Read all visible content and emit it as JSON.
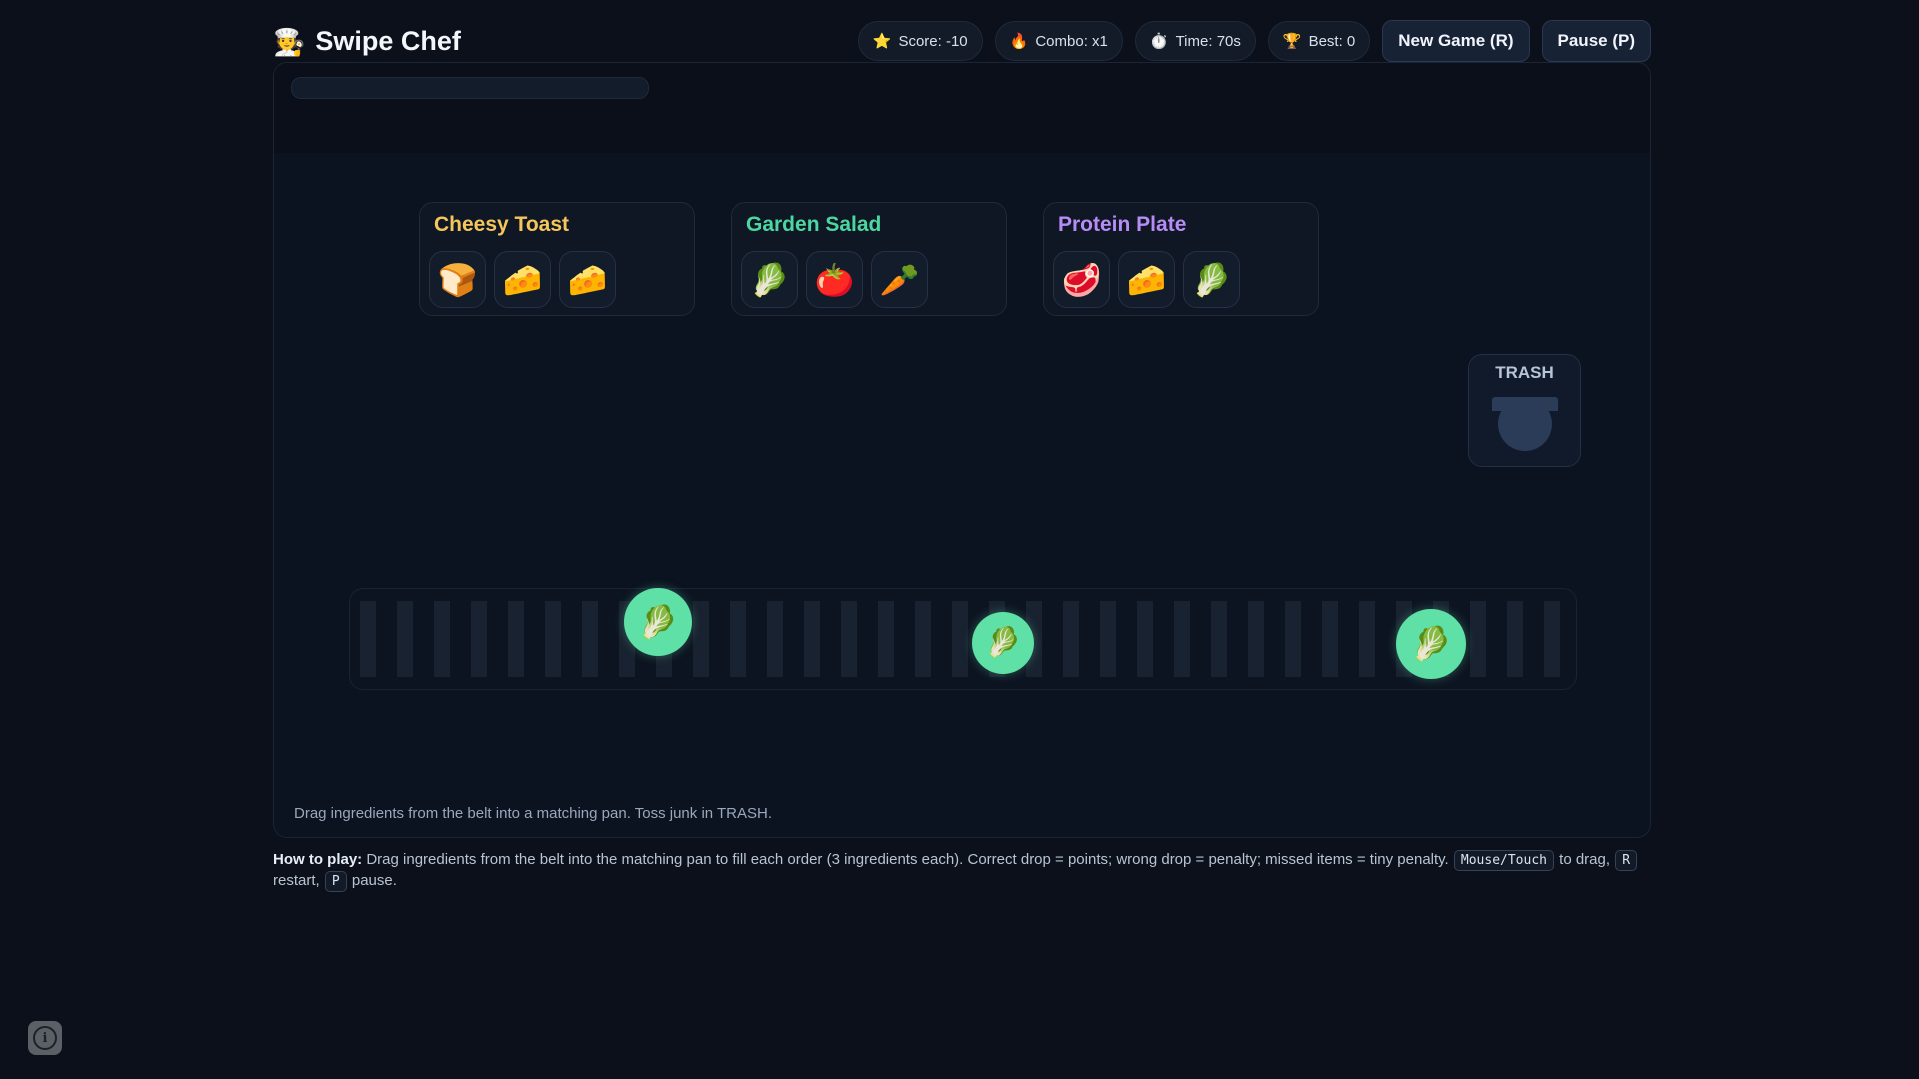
{
  "app": {
    "logo_icon": "🧑‍🍳",
    "title": "Swipe Chef"
  },
  "stats": {
    "score": {
      "icon": "⭐",
      "label": "Score: -10"
    },
    "combo": {
      "icon": "🔥",
      "label": "Combo: x1"
    },
    "time": {
      "icon": "⏱️",
      "label": "Time: 70s"
    },
    "best": {
      "icon": "🏆",
      "label": "Best: 0"
    }
  },
  "buttons": {
    "new_game": "New Game (R)",
    "pause": "Pause (P)"
  },
  "progress": 0,
  "orders": [
    {
      "name": "Cheesy Toast",
      "color": "#f5c75a",
      "items": [
        "🍞",
        "🧀",
        "🧀"
      ]
    },
    {
      "name": "Garden Salad",
      "color": "#4cd7a0",
      "items": [
        "🥬",
        "🍅",
        "🥕"
      ]
    },
    {
      "name": "Protein Plate",
      "color": "#b68cf5",
      "items": [
        "🥩",
        "🧀",
        "🥬"
      ]
    }
  ],
  "trash": {
    "label": "TRASH",
    "icon": "trash-bin-icon"
  },
  "belt_items": [
    {
      "icon": "🥬"
    },
    {
      "icon": "🥬"
    },
    {
      "icon": "🥬"
    }
  ],
  "board_hint": "Drag ingredients from the belt into a matching pan. Toss junk in TRASH.",
  "howto": {
    "heading": "How to play:",
    "text": " Drag ingredients from the belt into the matching pan to fill each order (3 ingredients each). Correct drop = points; wrong drop = penalty; missed items = tiny penalty. ",
    "key_drag": "Mouse/Touch",
    "after_drag": " to drag, ",
    "key_restart": "R",
    "after_restart": " restart, ",
    "key_pause": "P",
    "after_pause": " pause."
  },
  "colors": {
    "accent_green": "#5fe0a6",
    "background": "#0b101a"
  }
}
